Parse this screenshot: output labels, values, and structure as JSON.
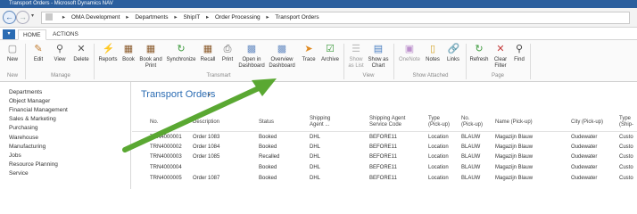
{
  "window": {
    "title": "Transport Orders - Microsoft Dynamics NAV"
  },
  "addressbar": {
    "crumbs": [
      "OMA Development",
      "Departments",
      "ShipIT",
      "Order Processing",
      "Transport Orders"
    ]
  },
  "ribbon_tabs": {
    "home": "HOME",
    "actions": "ACTIONS"
  },
  "ribbon": {
    "new": "New",
    "edit": "Edit",
    "view": "View",
    "delete": "Delete",
    "reports": "Reports",
    "book": "Book",
    "book_print_1": "Book and",
    "book_print_2": "Print",
    "synchronize": "Synchronize",
    "recall": "Recall",
    "print": "Print",
    "open_dash_1": "Open in",
    "open_dash_2": "Dashboard",
    "overview_dash_1": "Overview",
    "overview_dash_2": "Dashboard",
    "trace": "Trace",
    "archive": "Archive",
    "show_list_1": "Show",
    "show_list_2": "as List",
    "show_chart_1": "Show as",
    "show_chart_2": "Chart",
    "onenote": "OneNote",
    "notes": "Notes",
    "links": "Links",
    "refresh": "Refresh",
    "clear_filter_1": "Clear",
    "clear_filter_2": "Filter",
    "find": "Find",
    "groups": {
      "new": "New",
      "manage": "Manage",
      "transmart": "Transmart",
      "view": "View",
      "show_attached": "Show Attached",
      "page": "Page"
    }
  },
  "leftnav": {
    "items": [
      "Departments",
      "Object Manager",
      "Financial Management",
      "Sales & Marketing",
      "Purchasing",
      "Warehouse",
      "Manufacturing",
      "Jobs",
      "Resource Planning",
      "Service"
    ]
  },
  "page": {
    "title": "Transport Orders",
    "caret": "▾"
  },
  "table": {
    "headers": {
      "no": "No.",
      "description": "Description",
      "status": "Status",
      "agent_1": "Shipping",
      "agent_2": "Agent ...",
      "svc_1": "Shipping Agent",
      "svc_2": "Service Code",
      "type_1": "Type",
      "type_2": "(Pick-up)",
      "no_pick_1": "No.",
      "no_pick_2": "(Pick-up)",
      "name_pick": "Name (Pick-up)",
      "city_pick": "City (Pick-up)",
      "type_ship_1": "Type",
      "type_ship_2": "(Ship-"
    },
    "rows": [
      {
        "no": "TRN4000001",
        "desc": "Order 1083",
        "status": "Booked",
        "agent": "DHL",
        "svc": "BEFORE11",
        "type": "Location",
        "nopick": "BLAUW",
        "name": "Magazijn Blauw",
        "city": "Oudewater",
        "ship": "Custo"
      },
      {
        "no": "TRN4000002",
        "desc": "Order 1084",
        "status": "Booked",
        "agent": "DHL",
        "svc": "BEFORE11",
        "type": "Location",
        "nopick": "BLAUW",
        "name": "Magazijn Blauw",
        "city": "Oudewater",
        "ship": "Custo"
      },
      {
        "no": "TRN4000003",
        "desc": "Order 1085",
        "status": "Recalled",
        "agent": "DHL",
        "svc": "BEFORE11",
        "type": "Location",
        "nopick": "BLAUW",
        "name": "Magazijn Blauw",
        "city": "Oudewater",
        "ship": "Custo"
      },
      {
        "no": "TRN4000004",
        "desc": "",
        "status": "Booked",
        "agent": "DHL",
        "svc": "BEFORE11",
        "type": "Location",
        "nopick": "BLAUW",
        "name": "Magazijn Blauw",
        "city": "Oudewater",
        "ship": "Custo"
      },
      {
        "no": "TRN4000005",
        "desc": "Order 1087",
        "status": "Booked",
        "agent": "DHL",
        "svc": "BEFORE11",
        "type": "Location",
        "nopick": "BLAUW",
        "name": "Magazijn Blauw",
        "city": "Oudewater",
        "ship": "Custo"
      }
    ]
  },
  "colors": {
    "accent": "#2b6cb3",
    "arrow": "#5aa832",
    "titlebar": "#2b5f9e"
  },
  "icons": [
    "back-icon",
    "forward-icon",
    "home-icon",
    "new-icon",
    "edit-icon",
    "view-icon",
    "delete-icon",
    "reports-icon",
    "book-icon",
    "synchronize-icon",
    "recall-icon",
    "print-icon",
    "dashboard-icon",
    "trace-icon",
    "archive-icon",
    "list-icon",
    "chart-icon",
    "onenote-icon",
    "notes-icon",
    "links-icon",
    "refresh-icon",
    "clear-filter-icon",
    "find-icon"
  ]
}
